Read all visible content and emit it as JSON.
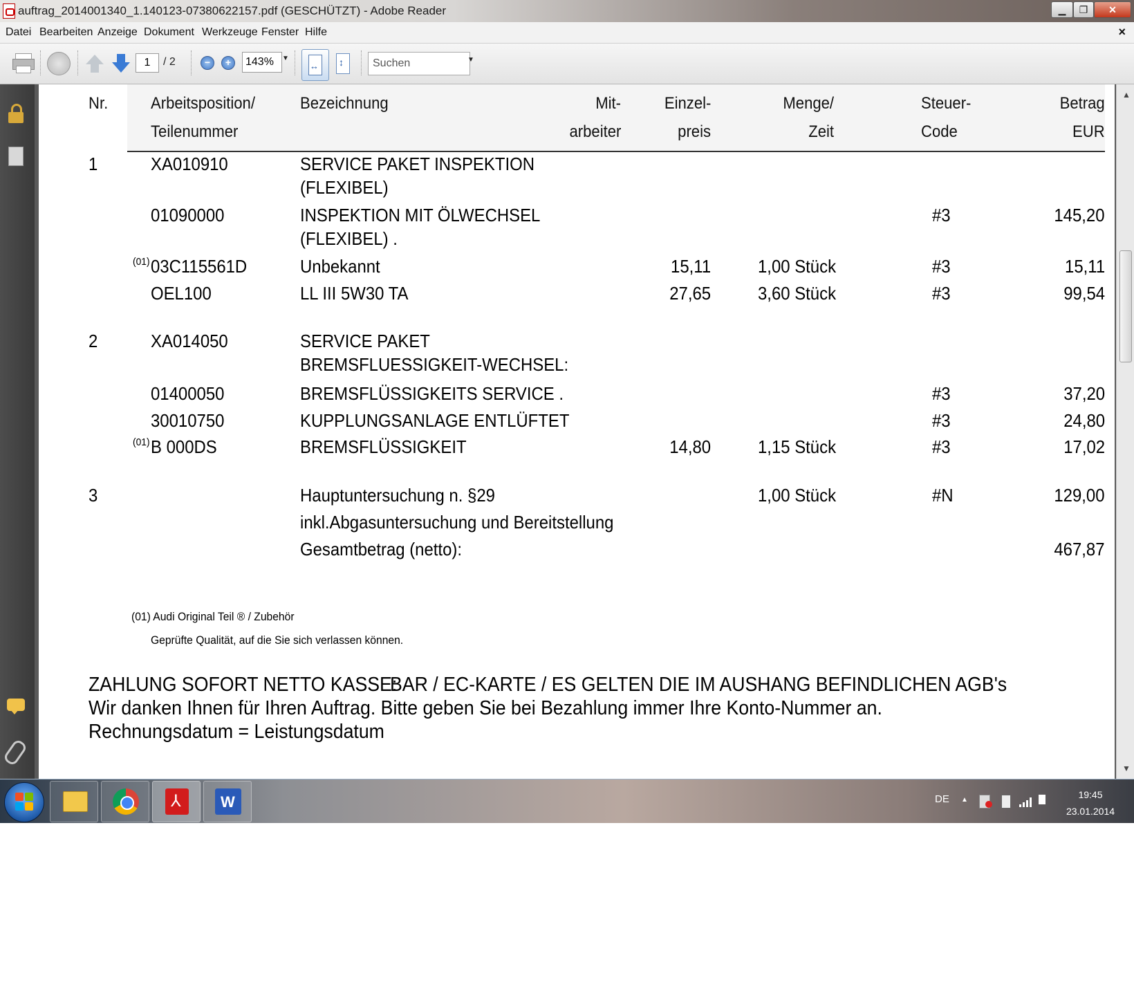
{
  "window": {
    "title": "auftrag_2014001340_1.140123-07380622157.pdf (GESCHÜTZT) - Adobe Reader",
    "minimize_label": "▁",
    "restore_label": "❐",
    "close_label": "✕"
  },
  "menu": {
    "items": [
      "Datei",
      "Bearbeiten",
      "Anzeige",
      "Dokument",
      "Werkzeuge",
      "Fenster",
      "Hilfe"
    ],
    "close_label": "×"
  },
  "toolbar": {
    "page_current": "1",
    "page_total": "/ 2",
    "zoom_out_label": "−",
    "zoom_in_label": "+",
    "zoom_value": "143%",
    "search_placeholder": "Suchen",
    "dropdown_glyph": "▼"
  },
  "table": {
    "headers": {
      "nr": "Nr.",
      "pos1": "Arbeitsposition/",
      "pos2": "Teilenummer",
      "bez": "Bezeichnung",
      "mit1": "Mit-",
      "mit2": "arbeiter",
      "ein1": "Einzel-",
      "ein2": "preis",
      "men1": "Menge/",
      "men2": "Zeit",
      "st1": "Steuer-",
      "st2": "Code",
      "bet1": "Betrag",
      "bet2": "EUR"
    },
    "rows": [
      {
        "nr": "1",
        "pos": "XA010910",
        "bez1": "SERVICE PAKET INSPEKTION",
        "bez2": "(FLEXIBEL)"
      },
      {
        "pos": "01090000",
        "bez1": "INSPEKTION MIT ÖLWECHSEL",
        "bez2": "(FLEXIBEL) .",
        "steuer": "#3",
        "betrag": "145,20"
      },
      {
        "sup": "(01)",
        "pos": "03C115561D",
        "bez1": "Unbekannt",
        "einzel": "15,11",
        "menge": "1,00 Stück",
        "steuer": "#3",
        "betrag": "15,11"
      },
      {
        "pos": "OEL100",
        "bez1": "LL III 5W30 TA",
        "einzel": "27,65",
        "menge": "3,60 Stück",
        "steuer": "#3",
        "betrag": "99,54"
      },
      {
        "nr": "2",
        "pos": "XA014050",
        "bez1": "SERVICE PAKET",
        "bez2": "BREMSFLUESSIGKEIT-WECHSEL:"
      },
      {
        "pos": "01400050",
        "bez1": "BREMSFLÜSSIGKEITS SERVICE .",
        "steuer": "#3",
        "betrag": "37,20"
      },
      {
        "pos": "30010750",
        "bez1": "KUPPLUNGSANLAGE ENTLÜFTET",
        "steuer": "#3",
        "betrag": "24,80"
      },
      {
        "sup": "(01)",
        "pos": "B  000DS",
        "bez1": "BREMSFLÜSSIGKEIT",
        "einzel": "14,80",
        "menge": "1,15 Stück",
        "steuer": "#3",
        "betrag": "17,02"
      },
      {
        "nr": "3",
        "bez1": "Hauptuntersuchung n. §29",
        "bez2": "inkl.Abgasuntersuchung und Bereitstellung",
        "menge": "1,00 Stück",
        "steuer": "#N",
        "betrag": "129,00"
      }
    ],
    "total_label": "Gesamtbetrag (netto):",
    "total_value": "467,87"
  },
  "footnote": {
    "line1": "(01) Audi Original Teil ® / Zubehör",
    "line2": "Geprüfte Qualität, auf die Sie sich verlassen können."
  },
  "payment": {
    "line1a": "ZAHLUNG SOFORT NETTO KASSE:",
    "line1b": "BAR  /  EC-KARTE  /  ES GELTEN DIE IM AUSHANG BEFINDLICHEN AGB's",
    "line2": "Wir danken Ihnen für Ihren Auftrag. Bitte geben Sie bei Bezahlung immer Ihre Konto-Nummer an.",
    "line3": "Rechnungsdatum = Leistungsdatum"
  },
  "taskbar": {
    "language": "DE",
    "tray_arrow": "▲",
    "time": "19:45",
    "date": "23.01.2014"
  },
  "colors": {
    "title_accent": "#c4381c",
    "rail": "#3f3f3f",
    "page": "#ffffff"
  }
}
